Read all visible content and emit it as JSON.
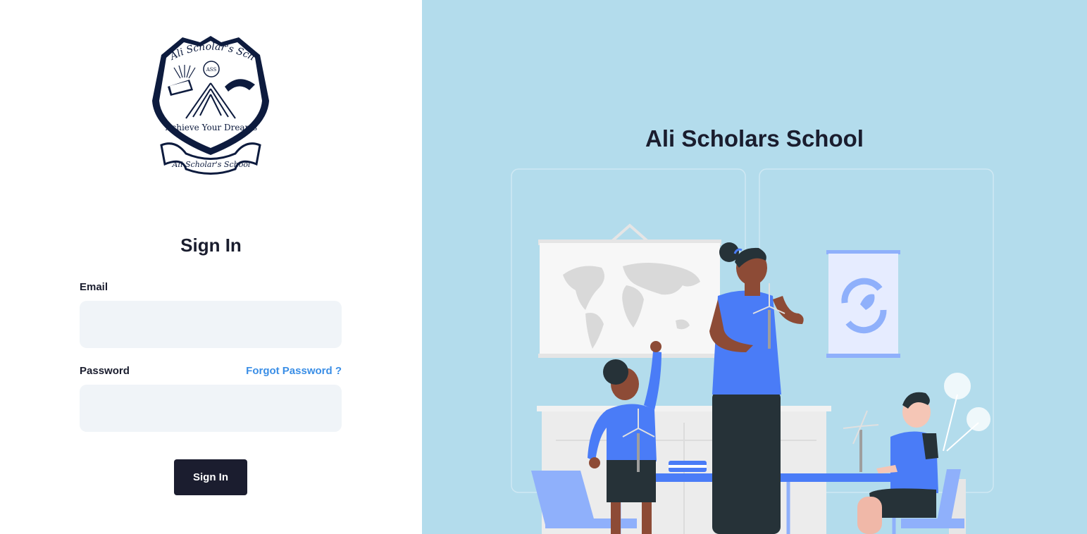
{
  "logo": {
    "top_text": "Ali Scholar's School",
    "motto": "Achieve Your Dreams",
    "ribbon_text": "Ali Scholar's School",
    "badge_text": "ASS"
  },
  "form": {
    "title": "Sign In",
    "email_label": "Email",
    "email_value": "",
    "password_label": "Password",
    "password_value": "",
    "forgot_label": "Forgot Password ?",
    "submit_label": "Sign In"
  },
  "hero": {
    "title": "Ali Scholars School",
    "illustration": "classroom-teacher-students-wind-turbines"
  },
  "colors": {
    "accent": "#3a8ee6",
    "button": "#1b1d2f",
    "panel_bg": "#b3dcec",
    "input_bg": "#f0f4f8",
    "figure_blue": "#4a7cf7"
  }
}
